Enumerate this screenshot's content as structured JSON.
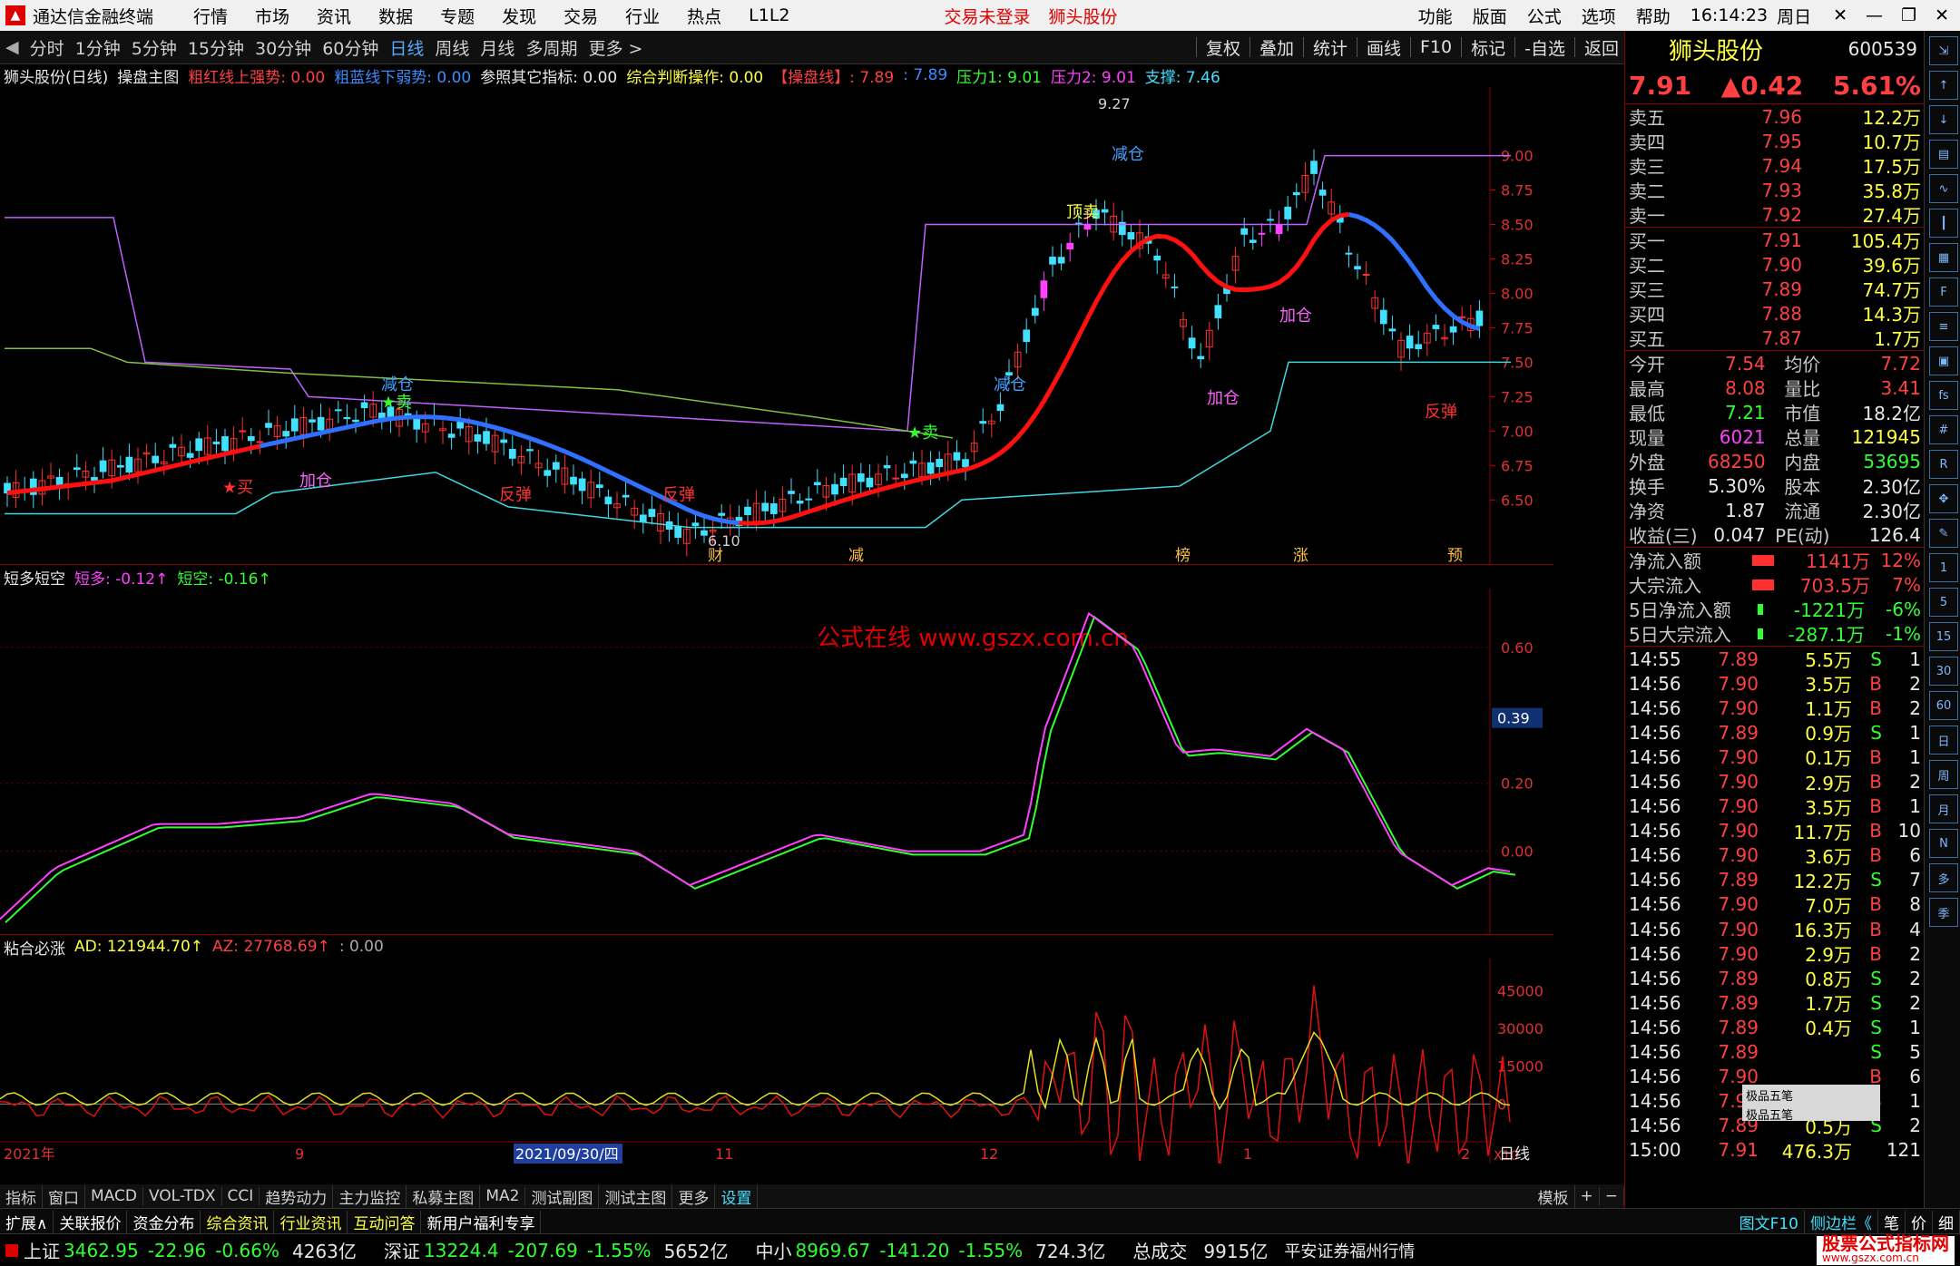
{
  "titlebar": {
    "app_name": "通达信金融终端",
    "menus": [
      "行情",
      "市场",
      "资讯",
      "数据",
      "专题",
      "发现",
      "交易",
      "行业",
      "热点",
      "L1L2"
    ],
    "trade_status": "交易未登录",
    "stock_name": "狮头股份",
    "right_menus": [
      "功能",
      "版面",
      "公式",
      "选项",
      "帮助"
    ],
    "time": "16:14:23",
    "weekday": "周日"
  },
  "periodbar": {
    "periods": [
      "分时",
      "1分钟",
      "5分钟",
      "15分钟",
      "30分钟",
      "60分钟",
      "日线",
      "周线",
      "月线",
      "多周期",
      "更多 >"
    ],
    "active": "日线",
    "right_items": [
      "复权",
      "叠加",
      "统计",
      "画线",
      "F10",
      "标记",
      "-自选",
      "返回"
    ]
  },
  "main_header": {
    "symbol": "狮头股份(日线)",
    "indicator": "操盘主图",
    "red_label": "粗红线上强势: 0.00",
    "blue_label": "粗蓝线下弱势: 0.00",
    "ref_label": "参照其它指标: 0.00",
    "op_label": "综合判断操作: 0.00",
    "line_label": "【操盘线】: 7.89",
    "line_val2": ": 7.89",
    "press1": "压力1: 9.01",
    "press2": "压力2: 9.01",
    "support": "支撑: 7.46"
  },
  "osc_header": {
    "name": "短多短空",
    "dd": "短多: -0.12↑",
    "dk": "短空: -0.16↑"
  },
  "ad_header": {
    "name": "粘合必涨",
    "ad": "AD: 121944.70↑",
    "az": "AZ: 27768.69↑",
    "other": ": 0.00"
  },
  "watermark": "公式在线  www.gszx.com.cn",
  "main_yaxis": [
    "9.00",
    "8.75",
    "8.50",
    "8.25",
    "8.00",
    "7.75",
    "7.50",
    "7.25",
    "7.00",
    "6.75",
    "6.50"
  ],
  "osc_yaxis": [
    "0.60",
    "0.39",
    "0.20",
    "0.00"
  ],
  "osc_current": "0.39",
  "ad_yaxis": [
    "45000",
    "30000",
    "15000",
    "0"
  ],
  "ad_unit": "X10",
  "xaxis": [
    "2021年",
    "9",
    "2021/09/30/四",
    "11",
    "12",
    "1",
    "2"
  ],
  "xaxis_mode": "日线",
  "price_high_label": "9.27",
  "price_low_label": "6.10",
  "signals": [
    "减仓",
    "★卖",
    "加仓",
    "★买",
    "反弹",
    "顶卖",
    "财",
    "减",
    "榜",
    "涨",
    "预"
  ],
  "quote": {
    "name": "狮头股份",
    "code": "600539",
    "price": "7.91",
    "change": "▲0.42",
    "pct": "5.61%",
    "sell": [
      {
        "label": "卖五",
        "price": "7.96",
        "vol": "12.2万"
      },
      {
        "label": "卖四",
        "price": "7.95",
        "vol": "10.7万"
      },
      {
        "label": "卖三",
        "price": "7.94",
        "vol": "17.5万"
      },
      {
        "label": "卖二",
        "price": "7.93",
        "vol": "35.8万"
      },
      {
        "label": "卖一",
        "price": "7.92",
        "vol": "27.4万"
      }
    ],
    "buy": [
      {
        "label": "买一",
        "price": "7.91",
        "vol": "105.4万"
      },
      {
        "label": "买二",
        "price": "7.90",
        "vol": "39.6万"
      },
      {
        "label": "买三",
        "price": "7.89",
        "vol": "74.7万"
      },
      {
        "label": "买四",
        "price": "7.88",
        "vol": "14.3万"
      },
      {
        "label": "买五",
        "price": "7.87",
        "vol": "1.7万"
      }
    ],
    "stats": [
      [
        "今开",
        "7.54",
        "均价",
        "7.72"
      ],
      [
        "最高",
        "8.08",
        "量比",
        "3.41"
      ],
      [
        "最低",
        "7.21",
        "市值",
        "18.2亿"
      ],
      [
        "现量",
        "6021",
        "总量",
        "121945"
      ],
      [
        "外盘",
        "68250",
        "内盘",
        "53695"
      ],
      [
        "换手",
        "5.30%",
        "股本",
        "2.30亿"
      ],
      [
        "净资",
        "1.87",
        "流通",
        "2.30亿"
      ],
      [
        "收益(三)",
        "0.047",
        "PE(动)",
        "126.4"
      ]
    ],
    "flows": [
      [
        "净流入额",
        "1141万",
        "12%"
      ],
      [
        "大宗流入",
        "703.5万",
        "7%"
      ],
      [
        "5日净流入额",
        "-1221万",
        "-6%"
      ],
      [
        "5日大宗流入",
        "-287.1万",
        "-1%"
      ]
    ],
    "ticks": [
      [
        "14:55",
        "7.89",
        "5.5万",
        "S",
        "1"
      ],
      [
        "14:56",
        "7.90",
        "3.5万",
        "B",
        "2"
      ],
      [
        "14:56",
        "7.90",
        "1.1万",
        "B",
        "2"
      ],
      [
        "14:56",
        "7.89",
        "0.9万",
        "S",
        "1"
      ],
      [
        "14:56",
        "7.90",
        "0.1万",
        "B",
        "1"
      ],
      [
        "14:56",
        "7.90",
        "2.9万",
        "B",
        "2"
      ],
      [
        "14:56",
        "7.90",
        "3.5万",
        "B",
        "1"
      ],
      [
        "14:56",
        "7.90",
        "11.7万",
        "B",
        "10"
      ],
      [
        "14:56",
        "7.90",
        "3.6万",
        "B",
        "6"
      ],
      [
        "14:56",
        "7.89",
        "12.2万",
        "S",
        "7"
      ],
      [
        "14:56",
        "7.90",
        "7.0万",
        "B",
        "8"
      ],
      [
        "14:56",
        "7.90",
        "16.3万",
        "B",
        "4"
      ],
      [
        "14:56",
        "7.90",
        "2.9万",
        "B",
        "2"
      ],
      [
        "14:56",
        "7.89",
        "0.8万",
        "S",
        "2"
      ],
      [
        "14:56",
        "7.89",
        "1.7万",
        "S",
        "2"
      ],
      [
        "14:56",
        "7.89",
        "0.4万",
        "S",
        "1"
      ],
      [
        "14:56",
        "7.89",
        "",
        "S",
        "5"
      ],
      [
        "14:56",
        "7.90",
        "",
        "B",
        "6"
      ],
      [
        "14:56",
        "7.90",
        "0.8万",
        "B",
        "1"
      ],
      [
        "14:56",
        "7.89",
        "0.5万",
        "S",
        "2"
      ],
      [
        "15:00",
        "7.91",
        "476.3万",
        "",
        "121"
      ]
    ]
  },
  "tabbar": {
    "tabs": [
      "指标",
      "窗口",
      "MACD",
      "VOL-TDX",
      "CCI",
      "趋势动力",
      "主力监控",
      "私募主图",
      "MA2",
      "测试副图",
      "测试主图",
      "更多",
      "设置"
    ],
    "active": "设置",
    "right": [
      "模板",
      "+",
      "−"
    ]
  },
  "extbar": {
    "items": [
      "扩展∧",
      "关联报价",
      "资金分布",
      "综合资讯",
      "行业资讯",
      "互动问答",
      "新用户福利专享"
    ],
    "right": [
      "图文F10",
      "侧边栏《",
      "笔",
      "价",
      "细"
    ]
  },
  "statusbar": {
    "items": [
      {
        "name": "上证",
        "val": "3462.95",
        "chg": "-22.96",
        "pct": "-0.66%",
        "amt": "4263亿"
      },
      {
        "name": "深证",
        "val": "13224.4",
        "chg": "-207.69",
        "pct": "-1.55%",
        "amt": "5652亿"
      },
      {
        "name": "中小",
        "val": "8969.67",
        "chg": "-141.20",
        "pct": "-1.55%",
        "amt": "724.3亿"
      }
    ],
    "total_label": "总成交",
    "total": "9915亿",
    "broker": "平安证券福州行情",
    "logo": "股票公式指标网",
    "logo_url": "www.gszx.com.cn"
  },
  "minitool": [
    "极品五笔",
    "极品五笔"
  ],
  "colors": {
    "up": "#ff4040",
    "down": "#30ff30",
    "ma_red": "#ff1010",
    "ma_blue": "#3070ff",
    "accent": "#40e0ff"
  }
}
